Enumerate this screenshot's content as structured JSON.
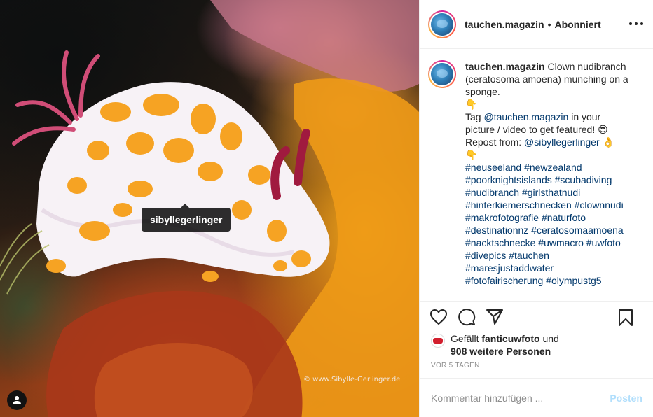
{
  "photo": {
    "tag_label": "sibyllegerlinger",
    "credit": "© www.Sibylle-Gerlinger.de",
    "user_tag_icon": "user-tag-icon"
  },
  "header": {
    "username": "tauchen.magazin",
    "separator": "•",
    "follow_status": "Abonniert",
    "more_icon": "more-options-icon"
  },
  "caption": {
    "username": "tauchen.magazin",
    "text_lines": [
      "Clown nudibranch",
      "(ceratosoma amoena) munching on a",
      "sponge."
    ],
    "point_down_emoji": "👇",
    "tag_prefix": "Tag ",
    "tag_handle": "@tauchen.magazin",
    "tag_suffix": " in your",
    "featured_line": "picture / video to get featured! ",
    "heart_eyes_emoji": "😍",
    "repost_prefix": "Repost from: ",
    "repost_handle": "@sibyllegerlinger",
    "ok_emoji": "👌",
    "point_down_emoji_2": "👇",
    "hashtag_lines": [
      "#neuseeland #newzealand",
      "#poorknightsislands #scubadiving",
      "#nudibranch #girlsthatnudi",
      "#hinterkiemerschnecken #clownnudi",
      "#makrofotografie #naturfoto",
      "#destinationnz #ceratosomaamoena",
      "#nacktschnecke #uwmacro #uwfoto",
      "#divepics #tauchen",
      "#maresjustaddwater",
      "#fotofairischerung #olympustg5"
    ]
  },
  "actions": {
    "like_icon": "heart-icon",
    "comment_icon": "comment-icon",
    "share_icon": "share-icon",
    "save_icon": "bookmark-icon"
  },
  "likes": {
    "prefix": "Gefällt ",
    "liker": "fanticuwfoto",
    "connector": " und",
    "others": "908 weitere Personen"
  },
  "timestamp": "VOR 5 TAGEN",
  "comment": {
    "placeholder": "Kommentar hinzufügen ...",
    "post_label": "Posten"
  },
  "colors": {
    "link": "#00376b",
    "muted": "#8e8e8e",
    "post_disabled": "#b2dffc",
    "divider": "#efefef"
  }
}
